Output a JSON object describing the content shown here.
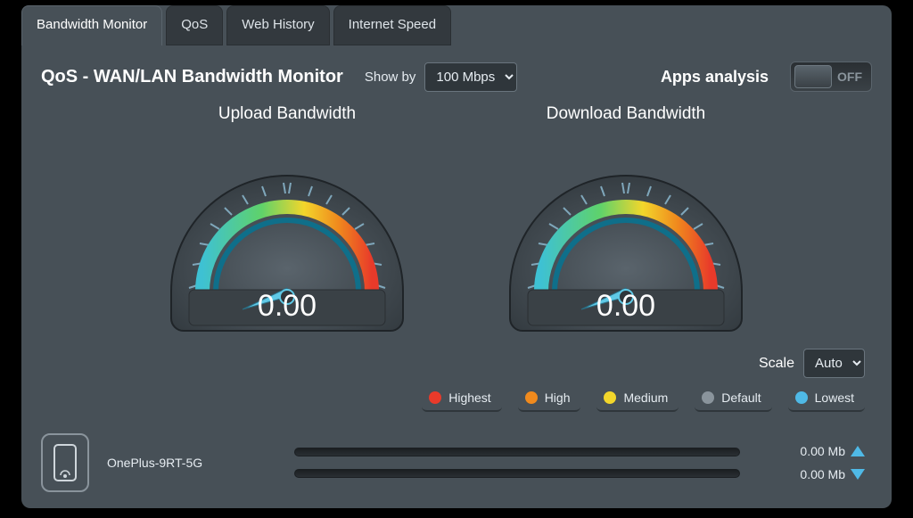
{
  "tabs": [
    {
      "label": "Bandwidth Monitor"
    },
    {
      "label": "QoS"
    },
    {
      "label": "Web History"
    },
    {
      "label": "Internet Speed"
    }
  ],
  "page_title": "QoS - WAN/LAN Bandwidth Monitor",
  "show_by": {
    "label": "Show by",
    "value": "100 Mbps"
  },
  "apps_analysis": {
    "label": "Apps analysis",
    "state": "OFF"
  },
  "gauges": {
    "upload": {
      "title": "Upload Bandwidth",
      "value": "0.00"
    },
    "download": {
      "title": "Download Bandwidth",
      "value": "0.00"
    }
  },
  "scale": {
    "label": "Scale",
    "value": "Auto"
  },
  "legend": [
    {
      "name": "Highest",
      "color": "#e83a2a"
    },
    {
      "name": "High",
      "color": "#f08a1d"
    },
    {
      "name": "Medium",
      "color": "#f2d62b"
    },
    {
      "name": "Default",
      "color": "#8a949c"
    },
    {
      "name": "Lowest",
      "color": "#4fb9e6"
    }
  ],
  "device": {
    "name": "OnePlus-9RT-5G",
    "upload_rate": "0.00 Mb",
    "download_rate": "0.00 Mb"
  }
}
